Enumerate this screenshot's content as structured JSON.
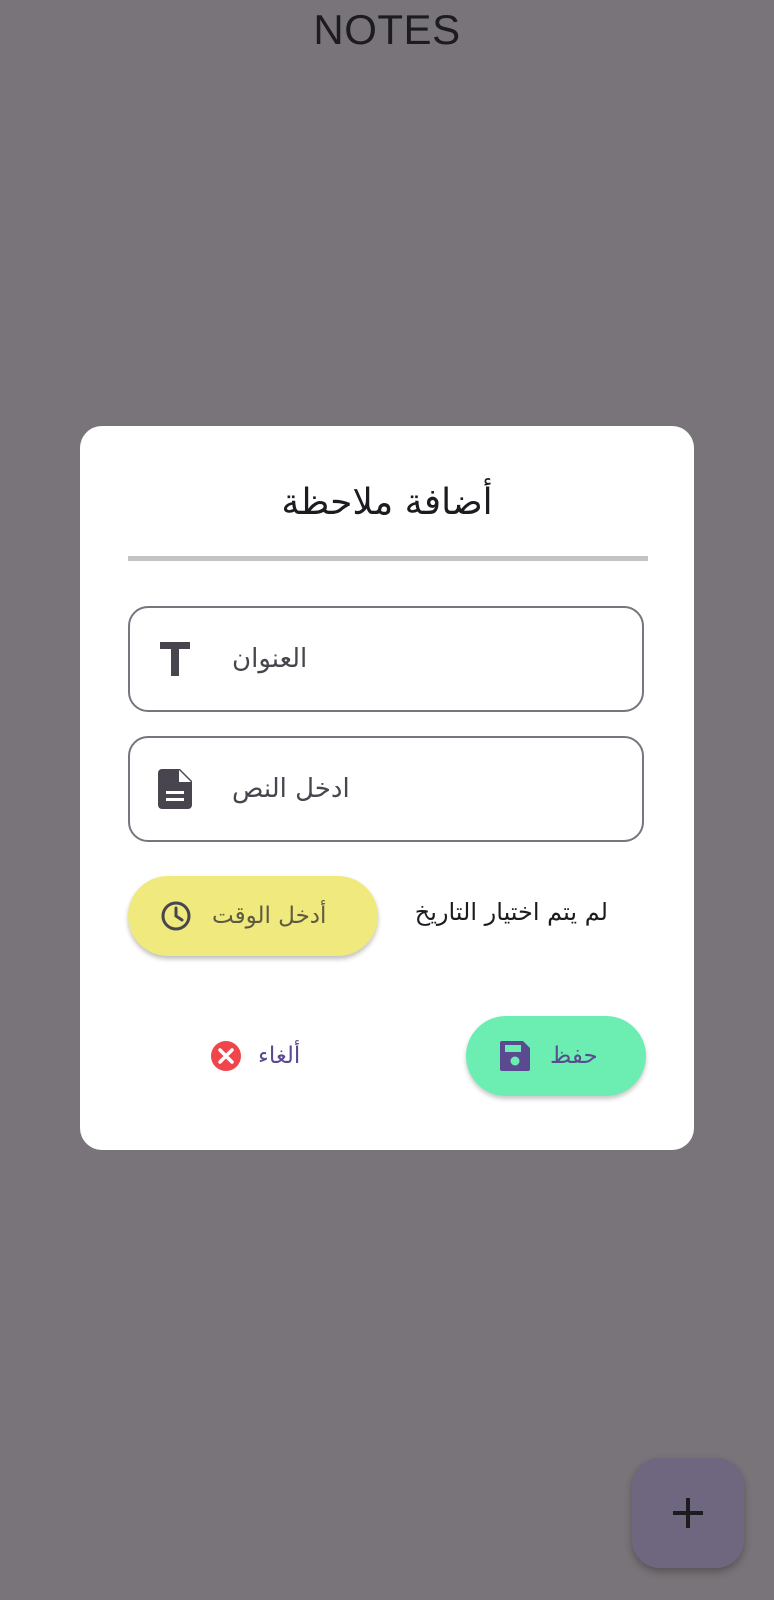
{
  "app": {
    "title": "NOTES"
  },
  "dialog": {
    "title": "أضافة ملاحظة",
    "title_field": {
      "placeholder": "العنوان",
      "icon": "text-title-icon"
    },
    "body_field": {
      "placeholder": "ادخل النص",
      "icon": "document-icon"
    },
    "time_button": {
      "label": "أدخل الوقت",
      "icon": "clock-icon"
    },
    "date_status": "لم يتم اختيار التاريخ",
    "save_button": {
      "label": "حفظ",
      "icon": "save-icon"
    },
    "cancel_button": {
      "label": "ألغاء",
      "icon": "cancel-circle-icon"
    }
  },
  "fab": {
    "icon": "plus-icon"
  },
  "colors": {
    "scrim": "#797479",
    "time_button": "#f0e97d",
    "save_button": "#6ceeb3",
    "cancel_icon": "#f0454b",
    "fab": "#6e677f"
  }
}
